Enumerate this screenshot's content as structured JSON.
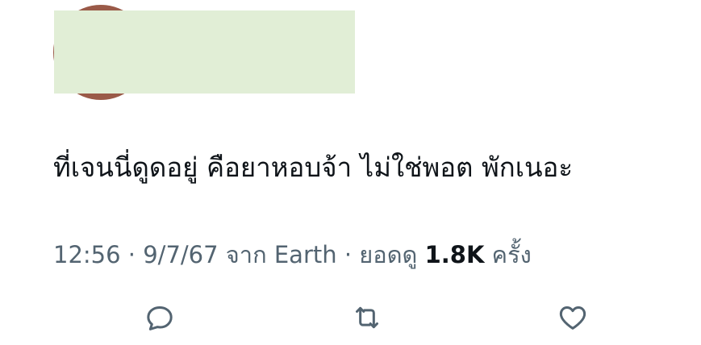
{
  "tweet": {
    "text": "ที่เจนนี่ดูดอยู่ คือยาหอบจ้า ไม่ใช่พอต พักเนอะ",
    "time": "12:56",
    "separator": "·",
    "date": "9/7/67",
    "source_prefix": "จาก",
    "source": "Earth",
    "views_prefix": "ยอดดู",
    "views_count": "1.8K",
    "views_suffix": "ครั้ง"
  },
  "actions": [
    {
      "name": "reply",
      "icon": "reply-icon"
    },
    {
      "name": "retweet",
      "icon": "retweet-icon"
    },
    {
      "name": "like",
      "icon": "heart-icon"
    }
  ],
  "colors": {
    "text": "#0f1419",
    "secondary": "#536471",
    "redaction": "#e1eed6",
    "avatar": "#9a5a48"
  }
}
